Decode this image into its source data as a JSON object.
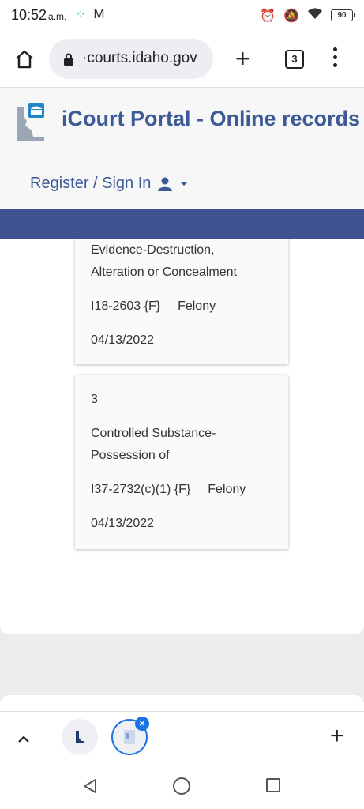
{
  "status_bar": {
    "time": "10:52",
    "ampm": "a.m.",
    "battery": "90"
  },
  "browser": {
    "url": "·courts.idaho.gov",
    "tab_count": "3"
  },
  "site": {
    "title": "iCourt Portal - Online records",
    "register_label": "Register / Sign In"
  },
  "charges": [
    {
      "description_line1": "Evidence-Destruction,",
      "description_line2": "Alteration or Concealment",
      "statute": "I18-2603 {F}",
      "degree": "Felony",
      "date": "04/13/2022"
    },
    {
      "number": "3",
      "description_line1": "Controlled Substance-",
      "description_line2": "Possession of",
      "statute": "I37-2732(c)(1) {F}",
      "degree": "Felony",
      "date": "04/13/2022"
    }
  ],
  "colors": {
    "brand": "#3d5a96",
    "nav_strip": "#3f5190",
    "accent": "#1a73e8"
  }
}
